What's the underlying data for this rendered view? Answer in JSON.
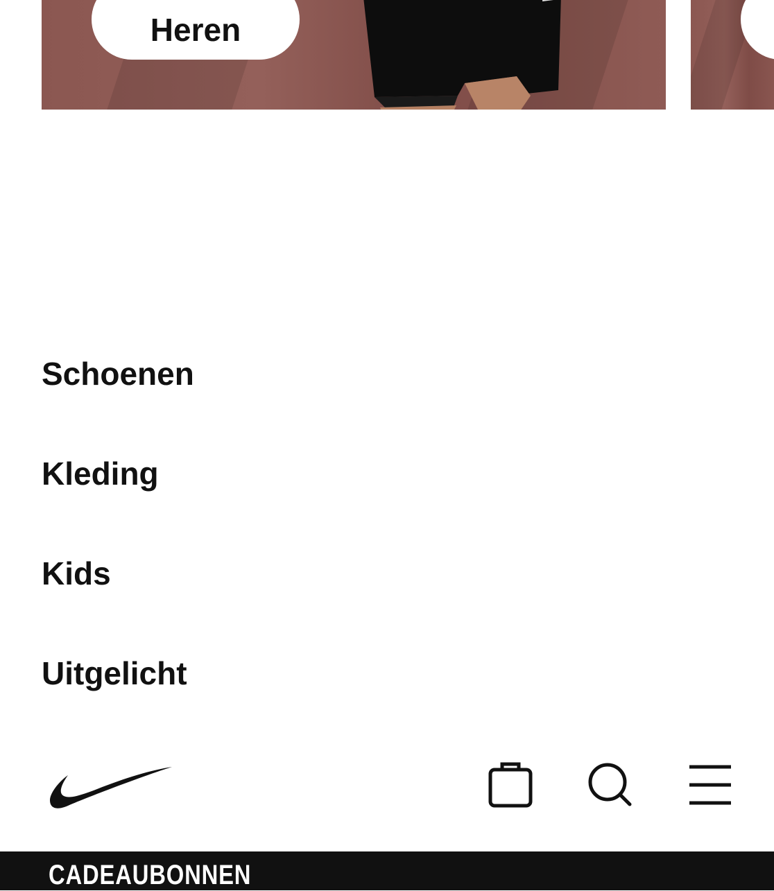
{
  "carousel": {
    "cards": [
      {
        "label": "Heren"
      },
      {
        "label": ""
      }
    ]
  },
  "nav": {
    "items": [
      {
        "label": "Schoenen"
      },
      {
        "label": "Kleding"
      },
      {
        "label": "Kids"
      },
      {
        "label": "Uitgelicht"
      }
    ]
  },
  "bottom_bar": {
    "logo": "nike-swoosh",
    "icons": [
      "shopping-bag-icon",
      "search-icon",
      "menu-icon"
    ]
  },
  "promo": {
    "label": "CADEAUBONNEN"
  },
  "colors": {
    "text": "#111111",
    "background": "#ffffff",
    "promo_bar": "#111111",
    "card_bg": "#8b5751"
  }
}
